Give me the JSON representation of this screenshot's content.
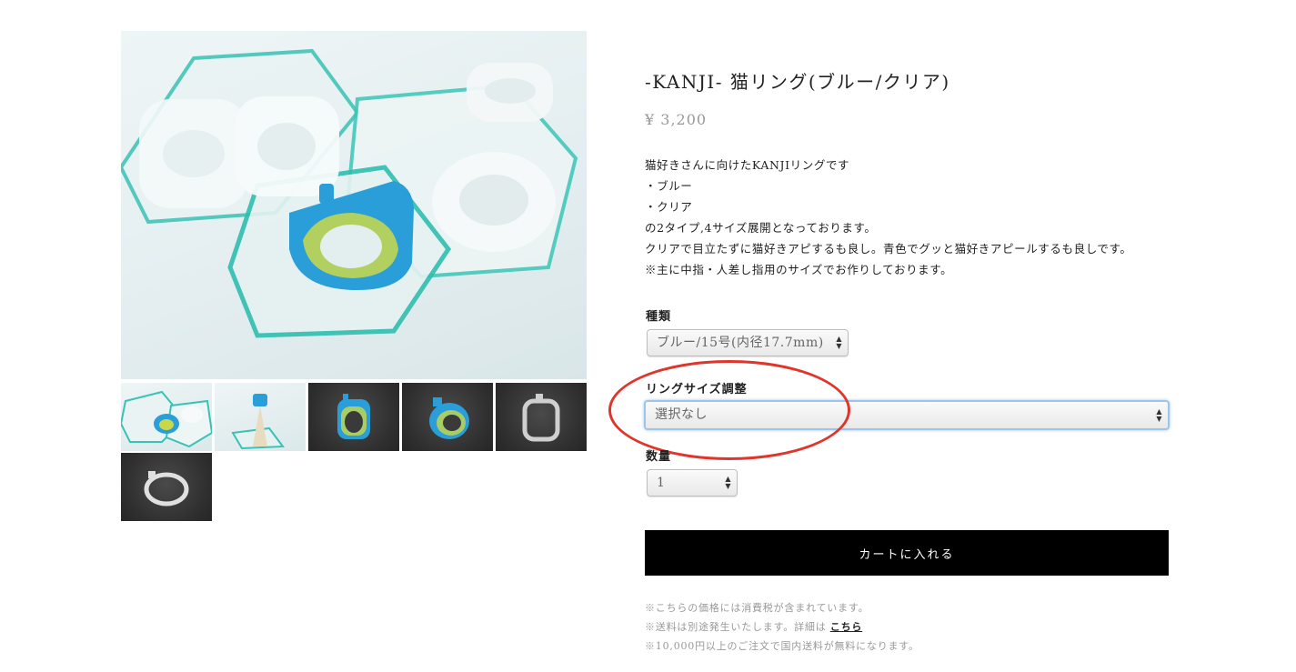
{
  "product": {
    "title": "-KANJI- 猫リング(ブルー/クリア)",
    "price": "¥ 3,200",
    "description": [
      "猫好きさんに向けたKANJIリングです",
      "・ブルー",
      "・クリア",
      "の2タイプ,4サイズ展開となっております。",
      "クリアで目立たずに猫好きアピするも良し。青色でグッと猫好きアピールするも良しです。",
      "※主に中指・人差し指用のサイズでお作りしております。"
    ]
  },
  "gallery": {
    "thumbnails": [
      {
        "icon": "ring-photo-blue-hexagons"
      },
      {
        "icon": "ring-photo-on-stand"
      },
      {
        "icon": "ring-photo-blue-dark"
      },
      {
        "icon": "ring-photo-blue-dark-angle"
      },
      {
        "icon": "ring-photo-clear-dark"
      },
      {
        "icon": "ring-photo-clear-dark-angle"
      }
    ]
  },
  "options": {
    "type": {
      "label": "種類",
      "selected": "ブルー/15号(内径17.7mm)"
    },
    "size_adjust": {
      "label": "リングサイズ調整",
      "selected": "選択なし"
    },
    "quantity": {
      "label": "数量",
      "selected": "1"
    }
  },
  "cart_button": "カートに入れる",
  "notes": {
    "tax": "※こちらの価格には消費税が含まれています。",
    "shipping_prefix": "※送料は別途発生いたします。詳細は",
    "shipping_link": "こちら",
    "free_shipping": "※10,000円以上のご注文で国内送料が無料になります。"
  },
  "colors": {
    "highlight": "#e0352b",
    "focus_ring": "#9cc4ec",
    "button_bg": "#000000",
    "price_text": "#999999"
  }
}
